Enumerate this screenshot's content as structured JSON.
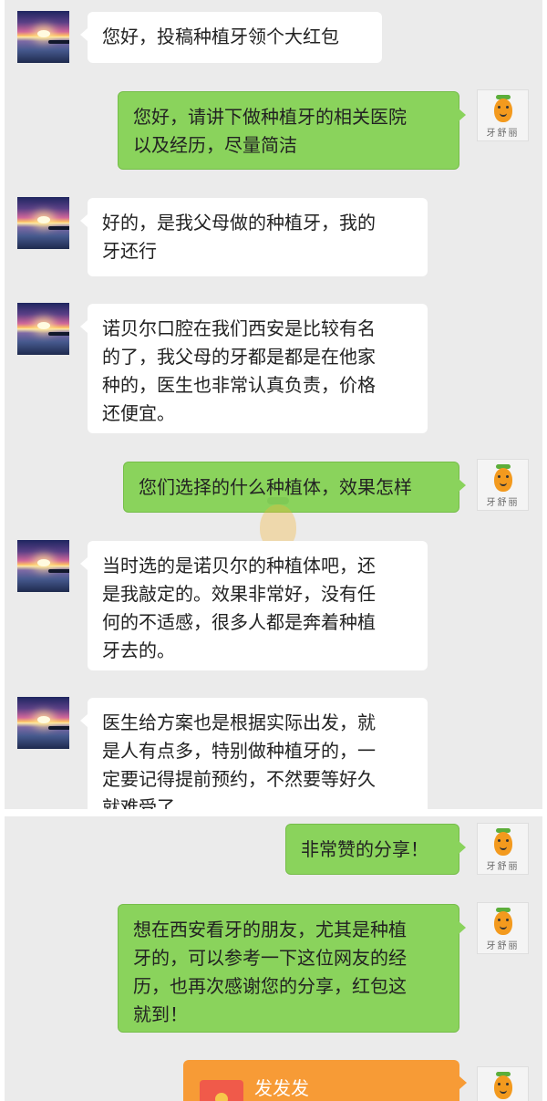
{
  "colors": {
    "chat_background": "#ebebeb",
    "incoming_bubble": "#ffffff",
    "outgoing_bubble": "#8ad35c",
    "red_packet": "#f79b36"
  },
  "brand": {
    "avatar_label": "牙舒丽",
    "avatar_icon": "carrot-mascot-icon"
  },
  "messages": [
    {
      "sender": "user",
      "lines": [
        "您好，投稿种植牙领个大红包"
      ]
    },
    {
      "sender": "brand",
      "lines": [
        "您好，请讲下做种植牙的相关医院",
        "以及经历，尽量简洁"
      ]
    },
    {
      "sender": "user",
      "lines": [
        "好的，是我父母做的种植牙，我的",
        "牙还行"
      ]
    },
    {
      "sender": "user",
      "lines": [
        "诺贝尔口腔在我们西安是比较有名",
        "的了，我父母的牙都是都是在他家",
        "种的，医生也非常认真负责，价格",
        "还便宜。"
      ]
    },
    {
      "sender": "brand",
      "lines": [
        "您们选择的什么种植体，效果怎样"
      ]
    },
    {
      "sender": "user",
      "lines": [
        "当时选的是诺贝尔的种植体吧，还",
        "是我敲定的。效果非常好，没有任",
        "何的不适感，很多人都是奔着种植",
        "牙去的。"
      ]
    },
    {
      "sender": "user",
      "lines": [
        "医生给方案也是根据实际出发，就",
        "是人有点多，特别做种植牙的，一",
        "定要记得提前预约，不然要等好久",
        "就难受了。"
      ]
    },
    {
      "sender": "brand",
      "lines": [
        "非常赞的分享！"
      ]
    },
    {
      "sender": "brand",
      "lines": [
        "想在西安看牙的朋友，尤其是种植",
        "牙的，可以参考一下这位网友的经",
        "历，也再次感谢您的分享，红包这",
        "就到！"
      ]
    }
  ],
  "red_packet": {
    "title": "发发发"
  }
}
